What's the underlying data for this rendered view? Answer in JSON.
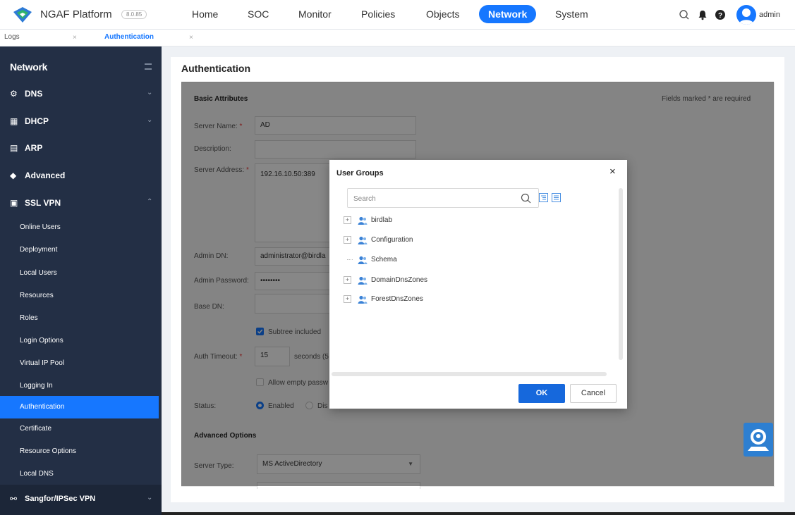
{
  "header": {
    "brand": "NGAF Platform",
    "version": "8.0.85",
    "nav": [
      {
        "label": "Home",
        "active": false
      },
      {
        "label": "SOC",
        "active": false
      },
      {
        "label": "Monitor",
        "active": false
      },
      {
        "label": "Policies",
        "active": false
      },
      {
        "label": "Objects",
        "active": false
      },
      {
        "label": "Network",
        "active": true
      },
      {
        "label": "System",
        "active": false
      }
    ],
    "user": "admin",
    "accent_color": "#1677ff"
  },
  "tabs": [
    {
      "label": "Logs",
      "active": false,
      "close": "×"
    },
    {
      "label": "Authentication",
      "active": true,
      "close": "×"
    }
  ],
  "sidebar": {
    "title": "Network",
    "sections": [
      {
        "label": "DNS",
        "icon": "dns-icon",
        "chevron": "⌄"
      },
      {
        "label": "DHCP",
        "icon": "dhcp-icon",
        "chevron": "⌄"
      },
      {
        "label": "ARP",
        "icon": "arp-icon",
        "chevron": ""
      },
      {
        "label": "Advanced",
        "icon": "advanced-icon",
        "chevron": ""
      },
      {
        "label": "SSL VPN",
        "icon": "ssl-vpn-icon",
        "chevron": "⌃"
      }
    ],
    "ssl_vpn_items": [
      {
        "label": "Online Users",
        "active": false
      },
      {
        "label": "Deployment",
        "active": false
      },
      {
        "label": "Local Users",
        "active": false
      },
      {
        "label": "Resources",
        "active": false
      },
      {
        "label": "Roles",
        "active": false
      },
      {
        "label": "Login Options",
        "active": false
      },
      {
        "label": "Virtual IP Pool",
        "active": false
      },
      {
        "label": "Logging In",
        "active": false
      },
      {
        "label": "Authentication",
        "active": true
      },
      {
        "label": "Certificate",
        "active": false
      },
      {
        "label": "Resource Options",
        "active": false
      },
      {
        "label": "Local DNS",
        "active": false
      }
    ],
    "bottom_section": {
      "label": "Sangfor/IPSec VPN",
      "chevron": "⌄"
    }
  },
  "main": {
    "title": "Authentication",
    "basic_attributes": "Basic Attributes",
    "required_note": "Fields marked * are required",
    "required_mark": "*",
    "server_name_label": "Server Name:",
    "server_name_value": "AD",
    "description_label": "Description:",
    "description_value": "",
    "server_address_label": "Server Address:",
    "server_address_value": "192.16.10.50:389",
    "admin_dn_label": "Admin DN:",
    "admin_dn_value": "administrator@birdla",
    "admin_password_label": "Admin Password:",
    "admin_password_value": "••••••••",
    "base_dn_label": "Base DN:",
    "base_dn_value": "",
    "subtree_label": "Subtree included",
    "subtree_checked": true,
    "auth_timeout_label": "Auth Timeout:",
    "auth_timeout_value": "15",
    "auth_timeout_unit": "seconds (5",
    "allow_empty_label": "Allow empty passw",
    "allow_empty_checked": false,
    "status_label": "Status:",
    "status_enabled": "Enabled",
    "status_disabled": "Dis",
    "status_value": "Enabled",
    "advanced_options": "Advanced Options",
    "server_type_label": "Server Type:",
    "server_type_value": "MS ActiveDirectory"
  },
  "modal": {
    "title": "User Groups",
    "close": "×",
    "search_placeholder": "Search",
    "tree": [
      {
        "label": "birdlab",
        "expandable": true,
        "expander": "+"
      },
      {
        "label": "Configuration",
        "expandable": true,
        "expander": "+"
      },
      {
        "label": "Schema",
        "expandable": false,
        "expander": ""
      },
      {
        "label": "DomainDnsZones",
        "expandable": true,
        "expander": "+"
      },
      {
        "label": "ForestDnsZones",
        "expandable": true,
        "expander": "+"
      }
    ],
    "ok_label": "OK",
    "cancel_label": "Cancel"
  }
}
